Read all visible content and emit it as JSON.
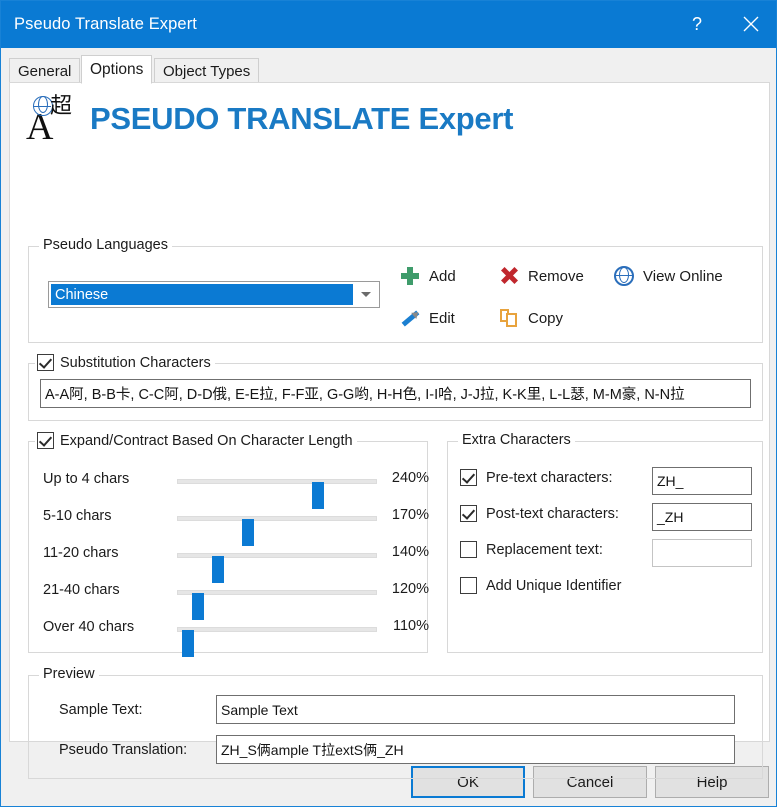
{
  "window": {
    "title": "Pseudo Translate Expert",
    "help_icon": "?",
    "close_icon": "✕"
  },
  "tabs": [
    {
      "label": "General",
      "active": false
    },
    {
      "label": "Options",
      "active": true
    },
    {
      "label": "Object Types",
      "active": false
    }
  ],
  "brand": {
    "title": "PSEUDO TRANSLATE Expert",
    "logo_letter": "A",
    "logo_cjk": "超",
    "accent_color": "#1a7ac4"
  },
  "pseudo_languages": {
    "group_label": "Pseudo Languages",
    "selected_language": "Chinese",
    "actions": [
      {
        "label": "Add",
        "icon": "plus-icon",
        "color": "#3f9c6b"
      },
      {
        "label": "Remove",
        "icon": "x-icon",
        "color": "#c0272d"
      },
      {
        "label": "View Online",
        "icon": "globe-icon",
        "color": "#2a6ebb"
      },
      {
        "label": "Edit",
        "icon": "pencil-icon",
        "color": "#1b7fd1"
      },
      {
        "label": "Copy",
        "icon": "copy-icon",
        "color": "#e8a33d"
      }
    ]
  },
  "substitution": {
    "group_label": "Substitution Characters",
    "checked": true,
    "value": "A-A阿, B-B卡, C-C阿, D-D俄, E-E拉, F-F亚, G-G哟, H-H色, I-I哈, J-J拉, K-K里, L-L瑟, M-M豪, N-N拉"
  },
  "expand_contract": {
    "group_label": "Expand/Contract Based On Character Length",
    "checked": true,
    "rows": [
      {
        "label": "Up to 4 chars",
        "value": "240%",
        "pct": 240
      },
      {
        "label": "5-10 chars",
        "value": "170%",
        "pct": 170
      },
      {
        "label": "11-20 chars",
        "value": "140%",
        "pct": 140
      },
      {
        "label": "21-40 chars",
        "value": "120%",
        "pct": 120
      },
      {
        "label": "Over 40 chars",
        "value": "110%",
        "pct": 110
      }
    ]
  },
  "extra_characters": {
    "group_label": "Extra Characters",
    "rows": [
      {
        "label": "Pre-text characters:",
        "checked": true,
        "value": "ZH_",
        "has_field": true,
        "enabled": true
      },
      {
        "label": "Post-text characters:",
        "checked": true,
        "value": "_ZH",
        "has_field": true,
        "enabled": true
      },
      {
        "label": "Replacement text:",
        "checked": false,
        "value": "",
        "has_field": true,
        "enabled": false
      },
      {
        "label": "Add Unique Identifier",
        "checked": false,
        "value": "",
        "has_field": false,
        "enabled": false
      }
    ]
  },
  "preview": {
    "group_label": "Preview",
    "sample_label": "Sample Text:",
    "sample_value": "Sample Text",
    "translation_label": "Pseudo Translation:",
    "translation_value": "ZH_S俩ample T拉extS俩_ZH"
  },
  "footer": {
    "ok": "OK",
    "cancel": "Cancel",
    "help": "Help"
  }
}
